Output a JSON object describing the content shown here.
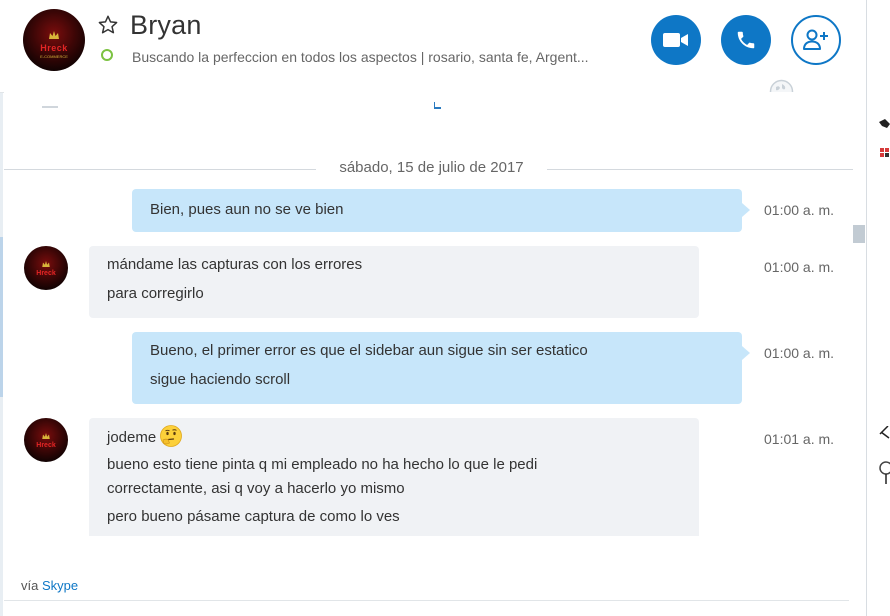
{
  "header": {
    "contact_name": "Bryan",
    "mood_message": "Buscando la perfeccion en todos los aspectos  |  rosario, santa fe, Argent...",
    "status": "online",
    "avatar_logo": "Hreck",
    "avatar_sub": "E-COMMERCE",
    "buttons": {
      "video_call": "video-camera-icon",
      "audio_call": "phone-icon",
      "add_people": "add-person-icon"
    }
  },
  "chat": {
    "date_separator": "sábado, 15 de julio de 2017",
    "messages": [
      {
        "direction": "out",
        "lines": [
          "Bien, pues aun no se ve bien"
        ],
        "time": "01:00 a. m."
      },
      {
        "direction": "in",
        "lines": [
          "mándame las capturas con los errores",
          "para corregirlo"
        ],
        "time": "01:00 a. m."
      },
      {
        "direction": "out",
        "lines": [
          "Bueno, el primer error es que el sidebar aun sigue sin ser estatico",
          "sigue haciendo scroll"
        ],
        "time": "01:00 a. m."
      },
      {
        "direction": "in",
        "lines": [
          "jodeme",
          "bueno esto tiene pinta q mi empleado no ha hecho lo que le pedi",
          "correctamente, asi q voy a hacerlo yo mismo",
          "pero bueno pásame captura de como lo ves"
        ],
        "time": "01:01 a. m.",
        "emoji": "thinking-face"
      }
    ]
  },
  "footer": {
    "via_prefix": "vía",
    "via_link": "Skype"
  },
  "colors": {
    "accent": "#0e77c6",
    "outgoing_bubble": "#c7e6fa",
    "incoming_bubble": "#f0f2f5",
    "online": "#7cc242"
  }
}
